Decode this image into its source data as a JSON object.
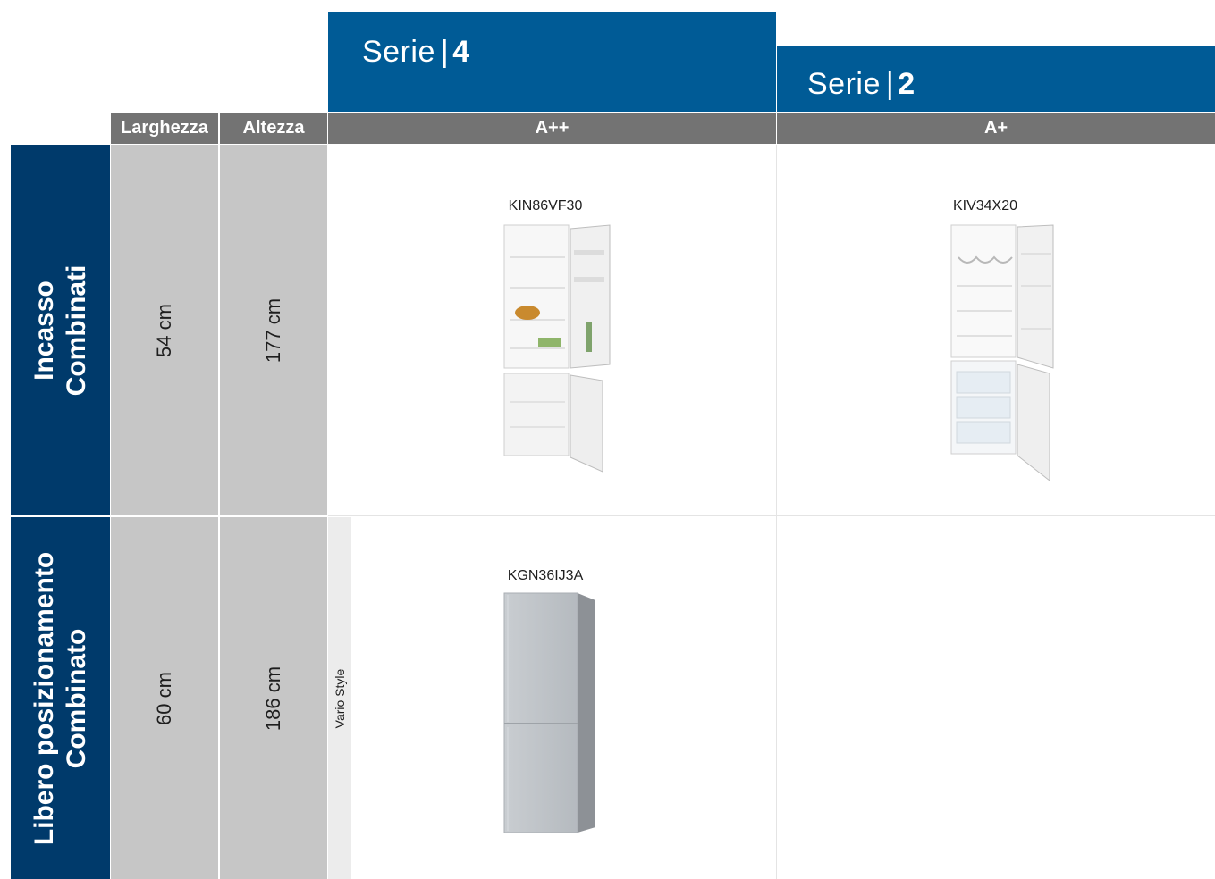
{
  "series": [
    {
      "prefix": "Serie",
      "sep": "|",
      "number": "4"
    },
    {
      "prefix": "Serie",
      "sep": "|",
      "number": "2"
    }
  ],
  "header": {
    "width_label": "Larghezza",
    "height_label": "Altezza",
    "energy_classes": [
      "A++",
      "A+"
    ]
  },
  "rows": [
    {
      "category_line1": "Incasso",
      "category_line2": "Combinati",
      "width": "54 cm",
      "height": "177 cm",
      "models": [
        "KIN86VF30",
        "KIV34X20"
      ]
    },
    {
      "category_line1": "Libero posizionamento",
      "category_line2": "Combinato",
      "width": "60 cm",
      "height": "186 cm",
      "tag": "Vario Style",
      "models": [
        "KGN36IJ3A"
      ]
    }
  ]
}
